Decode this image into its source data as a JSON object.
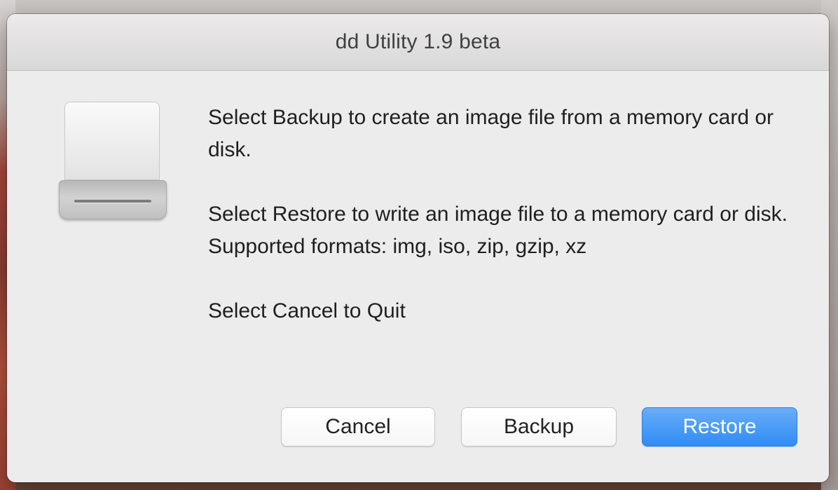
{
  "window": {
    "title": "dd Utility 1.9 beta"
  },
  "icon": {
    "name": "external-drive-icon"
  },
  "message": {
    "backup_line": "Select Backup to create an image file from a memory card or disk.",
    "restore_line": "Select Restore to write an image file to a memory card or disk.",
    "formats_line": "Supported formats: img, iso, zip, gzip, xz",
    "cancel_line": "Select Cancel to Quit"
  },
  "buttons": {
    "cancel_label": "Cancel",
    "backup_label": "Backup",
    "restore_label": "Restore"
  },
  "colors": {
    "accent": "#2f8cf6",
    "window_bg": "#ececec"
  }
}
